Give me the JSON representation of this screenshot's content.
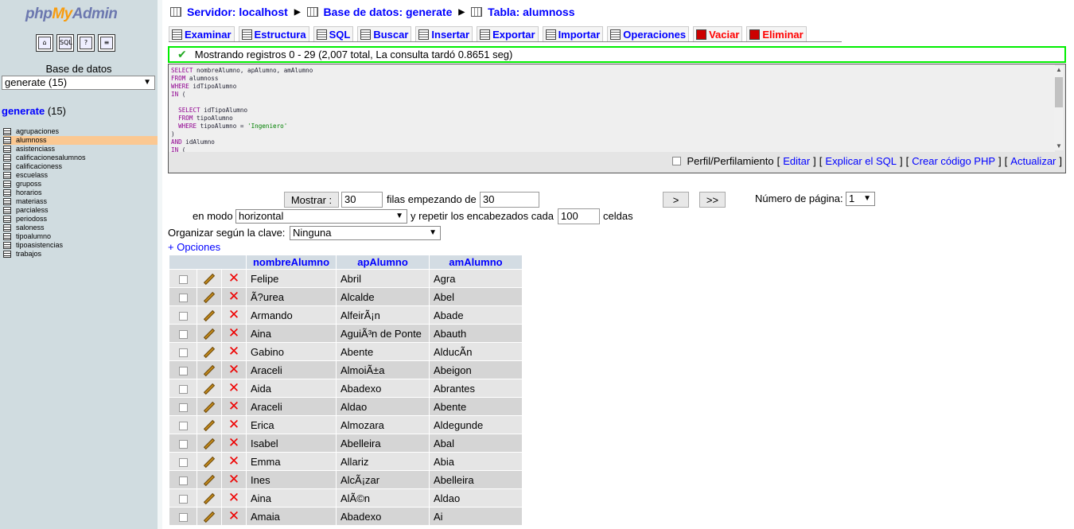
{
  "left": {
    "logo": {
      "php": "php",
      "my": "My",
      "admin": "Admin"
    },
    "icons": [
      "home-icon",
      "sql-query-icon",
      "help-icon",
      "docs-icon"
    ],
    "db_label": "Base de datos",
    "db_select": "generate (15)",
    "db_title": "generate",
    "db_count": "(15)",
    "tables": [
      "agrupaciones",
      "alumnoss",
      "asistenciass",
      "calificacionesalumnos",
      "calificacioness",
      "escuelass",
      "gruposs",
      "horarios",
      "materiass",
      "parcialess",
      "periodoss",
      "saloness",
      "tipoalumno",
      "tipoasistencias",
      "trabajos"
    ],
    "active_table": "alumnoss"
  },
  "breadcrumb": {
    "server": "Servidor: localhost",
    "database": "Base de datos: generate",
    "table": "Tabla: alumnoss"
  },
  "tabs": [
    "Examinar",
    "Estructura",
    "SQL",
    "Buscar",
    "Insertar",
    "Exportar",
    "Importar",
    "Operaciones",
    "Vaciar",
    "Eliminar"
  ],
  "notice": "Mostrando registros 0 - 29 (2,007 total, La consulta tardó 0.8651 seg)",
  "sql_links": {
    "profiling": "Perfil/Perfilamiento",
    "edit": "Editar",
    "explain": "Explicar el SQL",
    "php_code": "Crear código PHP",
    "refresh": "Actualizar"
  },
  "nav": {
    "show_button": "Mostrar :",
    "rows_value": "30",
    "rows_label": "filas empezando de",
    "start_value": "30",
    "next_button": ">",
    "last_button": ">>",
    "page_label": "Número de página:",
    "page_value": "1",
    "mode_label": "en modo",
    "mode_value": "horizontal",
    "repeat_label": "y repetir los encabezados cada",
    "repeat_value": "100",
    "cells_label": "celdas",
    "sort_label": "Organizar según la clave:",
    "sort_value": "Ninguna",
    "options_link": "+ Opciones"
  },
  "columns": [
    "nombreAlumno",
    "apAlumno",
    "amAlumno"
  ],
  "rows": [
    [
      "Felipe",
      "Abril",
      "Agra"
    ],
    [
      "Ã?urea",
      "Alcalde",
      "Abel"
    ],
    [
      "Armando",
      "AlfeirÃ¡n",
      "Abade"
    ],
    [
      "Aina",
      "AguiÃ³n de Ponte",
      "Abauth"
    ],
    [
      "Gabino",
      "Abente",
      "AlducÃ­n"
    ],
    [
      "Araceli",
      "AlmoiÃ±a",
      "Abeigon"
    ],
    [
      "Aida",
      "Abadexo",
      "Abrantes"
    ],
    [
      "Araceli",
      "Aldao",
      "Abente"
    ],
    [
      "Erica",
      "Almozara",
      "Aldegunde"
    ],
    [
      "Isabel",
      "Abelleira",
      "Abal"
    ],
    [
      "Emma",
      "Allariz",
      "Abia"
    ],
    [
      "Ines",
      "AlcÃ¡zar",
      "Abelleira"
    ],
    [
      "Aina",
      "AlÃ©n",
      "Aldao"
    ],
    [
      "Amaia",
      "Abadexo",
      "Ai"
    ]
  ]
}
